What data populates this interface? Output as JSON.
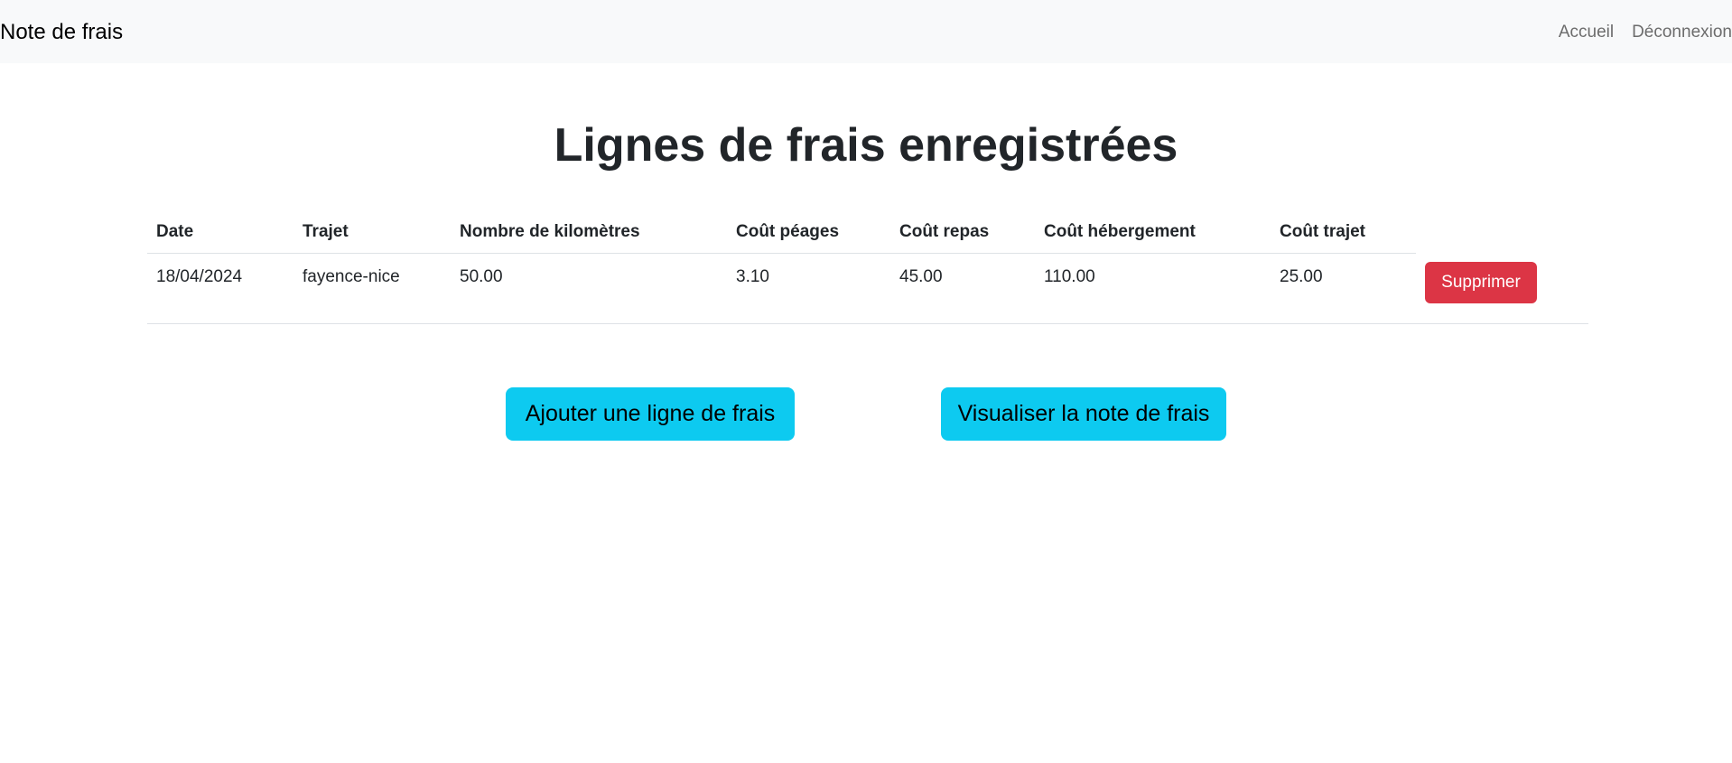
{
  "navbar": {
    "brand": "Note de frais",
    "links": [
      "Accueil",
      "Déconnexion"
    ]
  },
  "page": {
    "title": "Lignes de frais enregistrées"
  },
  "table": {
    "headers": [
      "Date",
      "Trajet",
      "Nombre de kilomètres",
      "Coût péages",
      "Coût repas",
      "Coût hébergement",
      "Coût trajet",
      ""
    ],
    "rows": [
      {
        "date": "18/04/2024",
        "trajet": "fayence-nice",
        "kilometres": "50.00",
        "peages": "3.10",
        "repas": "45.00",
        "hebergement": "110.00",
        "cout_trajet": "25.00",
        "action_label": "Supprimer"
      }
    ]
  },
  "actions": {
    "add_label": "Ajouter une ligne de frais",
    "view_label": "Visualiser la note de frais"
  },
  "colors": {
    "navbar_bg": "#f8f9fa",
    "danger": "#dc3545",
    "info": "#0dcaf0"
  }
}
